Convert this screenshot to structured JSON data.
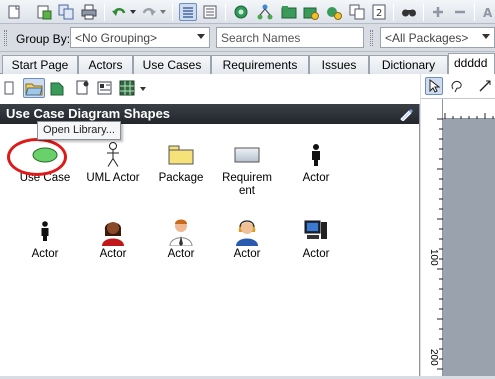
{
  "filter_bar": {
    "group_by_label": "Group By:",
    "grouping_value": "<No Grouping>",
    "search_placeholder": "Search Names",
    "packages_value": "<All Packages>"
  },
  "tabs": [
    {
      "label": "Start Page"
    },
    {
      "label": "Actors"
    },
    {
      "label": "Use Cases"
    },
    {
      "label": "Requirements"
    },
    {
      "label": "Issues"
    },
    {
      "label": "Dictionary"
    },
    {
      "label": "ddddd"
    }
  ],
  "panel": {
    "title": "Use Case Diagram Shapes",
    "tooltip": "Open Library..."
  },
  "shapes": [
    {
      "label": "Use Case",
      "icon": "use-case-ellipse-icon"
    },
    {
      "label": "UML Actor",
      "icon": "stick-figure-icon"
    },
    {
      "label": "Package",
      "icon": "folder-icon"
    },
    {
      "label": "Requirement",
      "icon": "requirement-box-icon"
    },
    {
      "label": "Actor",
      "icon": "person-silhouette-icon"
    },
    {
      "label": "Actor",
      "icon": "person-silhouette-small-icon"
    },
    {
      "label": "Actor",
      "icon": "woman-avatar-icon"
    },
    {
      "label": "Actor",
      "icon": "man-avatar-icon"
    },
    {
      "label": "Actor",
      "icon": "woman-headset-icon"
    },
    {
      "label": "Actor",
      "icon": "computer-icon"
    }
  ],
  "ruler": {
    "marks": [
      "100",
      "200"
    ]
  },
  "colors": {
    "highlight_circle": "#e01818",
    "title_bar": "#2b3036"
  }
}
